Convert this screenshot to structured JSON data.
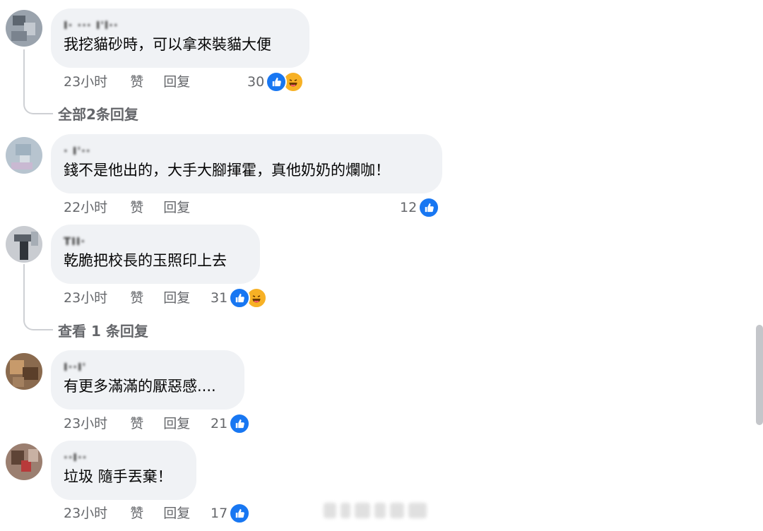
{
  "comments": [
    {
      "author": "I· ··· I'l··",
      "text": "我挖貓砂時，可以拿來裝貓大便",
      "time": "23小时",
      "like": "赞",
      "reply": "回复",
      "reaction_count": "30",
      "reactions": [
        "like-icon",
        "haha-icon"
      ],
      "replies_label": "全部2条回复"
    },
    {
      "author": "· I'··",
      "text": "錢不是他出的，大手大腳揮霍，真他奶奶的爛咖！",
      "time": "22小时",
      "like": "赞",
      "reply": "回复",
      "reaction_count": "12",
      "reactions": [
        "like-icon"
      ]
    },
    {
      "author": "TII·",
      "text": "乾脆把校長的玉照印上去",
      "time": "23小时",
      "like": "赞",
      "reply": "回复",
      "reaction_count": "31",
      "reactions": [
        "like-icon",
        "haha-icon"
      ],
      "replies_label": "查看 1 条回复"
    },
    {
      "author": "I··I'",
      "text": "有更多滿滿的厭惡感....",
      "time": "23小时",
      "like": "赞",
      "reply": "回复",
      "reaction_count": "21",
      "reactions": [
        "like-icon"
      ]
    },
    {
      "author": "··I··",
      "text": "垃圾 隨手丟棄！",
      "time": "23小时",
      "like": "赞",
      "reply": "回复",
      "reaction_count": "17",
      "reactions": [
        "like-icon"
      ]
    }
  ],
  "colors": {
    "bubble": "#f0f2f5",
    "meta_text": "#65676b",
    "like_blue": "#1877f2",
    "haha_yellow": "#f7b125"
  }
}
